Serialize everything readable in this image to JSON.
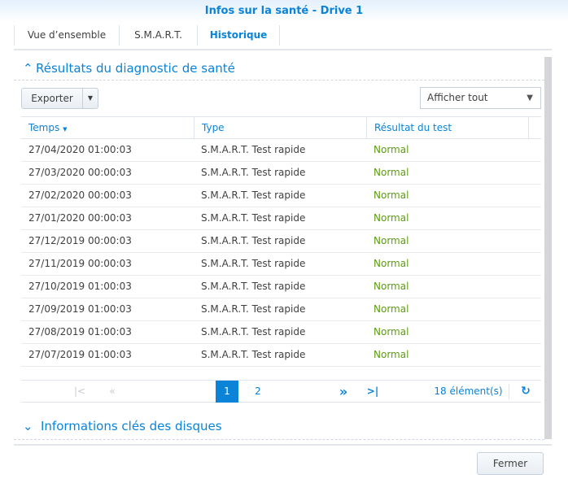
{
  "title": "Infos sur la santé - Drive 1",
  "tabs": [
    {
      "label": "Vue d’ensemble"
    },
    {
      "label": "S.M.A.R.T."
    },
    {
      "label": "Historique"
    }
  ],
  "section1": {
    "title": "Résultats du diagnostic de santé",
    "export_label": "Exporter",
    "filter_value": "Afficher tout"
  },
  "table": {
    "headers": [
      "Temps",
      "Type",
      "Résultat du test"
    ],
    "rows": [
      [
        "27/04/2020 01:00:03",
        "S.M.A.R.T. Test rapide",
        "Normal"
      ],
      [
        "27/03/2020 00:00:03",
        "S.M.A.R.T. Test rapide",
        "Normal"
      ],
      [
        "27/02/2020 00:00:03",
        "S.M.A.R.T. Test rapide",
        "Normal"
      ],
      [
        "27/01/2020 00:00:03",
        "S.M.A.R.T. Test rapide",
        "Normal"
      ],
      [
        "27/12/2019 00:00:03",
        "S.M.A.R.T. Test rapide",
        "Normal"
      ],
      [
        "27/11/2019 00:00:03",
        "S.M.A.R.T. Test rapide",
        "Normal"
      ],
      [
        "27/10/2019 01:00:03",
        "S.M.A.R.T. Test rapide",
        "Normal"
      ],
      [
        "27/09/2019 01:00:03",
        "S.M.A.R.T. Test rapide",
        "Normal"
      ],
      [
        "27/08/2019 01:00:03",
        "S.M.A.R.T. Test rapide",
        "Normal"
      ],
      [
        "27/07/2019 01:00:03",
        "S.M.A.R.T. Test rapide",
        "Normal"
      ]
    ]
  },
  "pager": {
    "pages": [
      "1",
      "2"
    ],
    "current": "1",
    "count": "18 élément(s)"
  },
  "section2": {
    "title": "Informations clés des disques"
  },
  "close_label": "Fermer"
}
